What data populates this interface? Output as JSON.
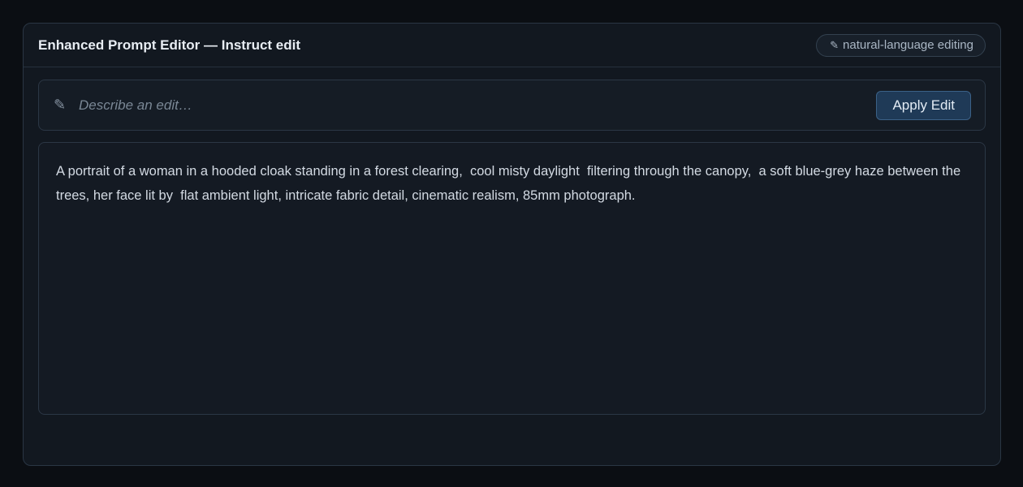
{
  "header": {
    "title": "Enhanced Prompt Editor — Instruct edit",
    "badge_icon": "pencil-icon",
    "badge_icon_glyph": "✎",
    "badge_label": "natural-language editing"
  },
  "instruct": {
    "icon": "pencil-icon",
    "icon_glyph": "✎",
    "placeholder": "Describe an edit…",
    "value": "",
    "apply_label": "Apply Edit"
  },
  "prompt": {
    "segments": [
      "A portrait of a woman in a hooded cloak standing in a forest clearing, ",
      " cool misty daylight ",
      " filtering through the canopy, ",
      " a soft blue-grey haze between the trees, her face lit by ",
      " flat ambient light",
      ", intricate fabric detail, cinematic realism, 85mm photograph."
    ]
  },
  "colors": {
    "background": "#0b0e13",
    "panel": "#121820",
    "accent_button": "#1f3a57"
  }
}
